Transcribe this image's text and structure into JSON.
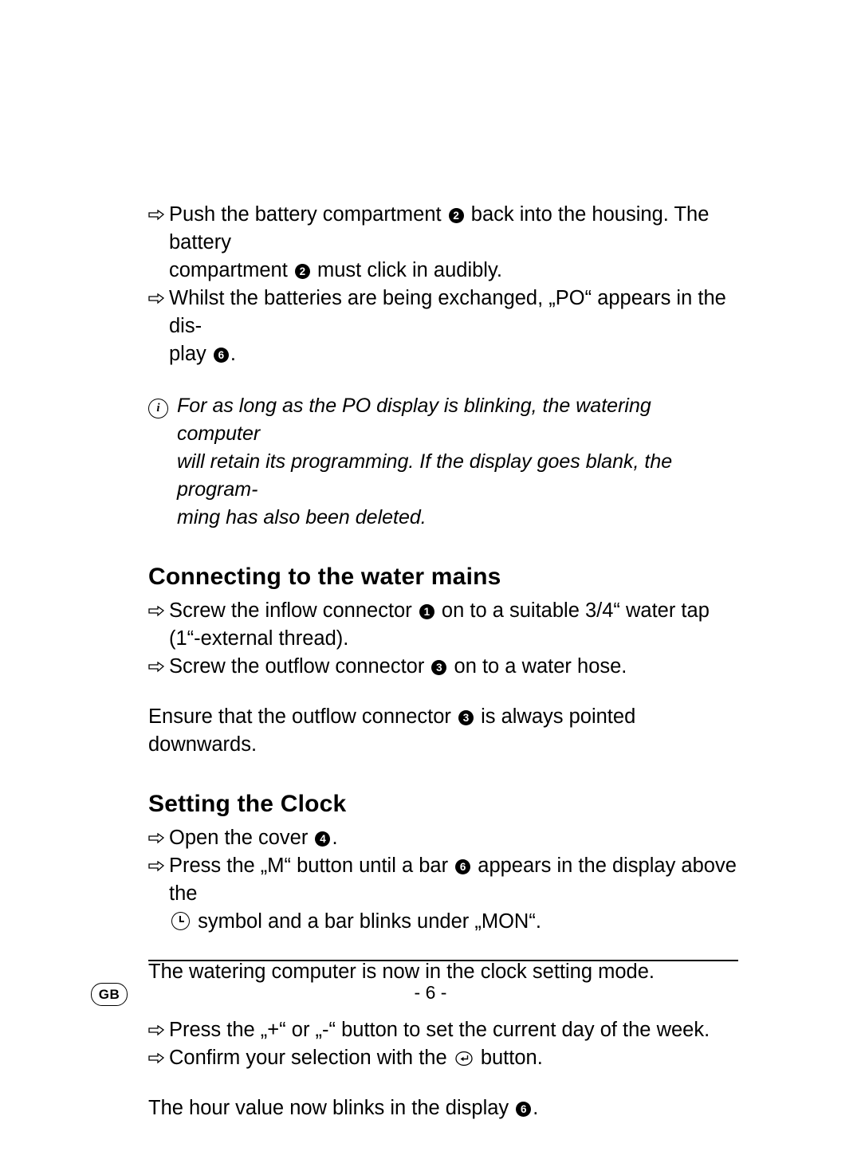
{
  "page": {
    "footer": {
      "language_badge": "GB",
      "page_number": "- 6 -"
    }
  },
  "blocks": {
    "b1": {
      "text_a": "Push the battery compartment ",
      "marker_a": "2",
      "text_b": " back into the housing. The battery",
      "text_c": "compartment ",
      "marker_b": "2",
      "text_d": " must click in audibly."
    },
    "b2": {
      "text_a": "Whilst the batteries are being exchanged, „PO“ appears in the dis-",
      "text_b": "play ",
      "marker_a": "6",
      "text_c": "."
    },
    "note": {
      "icon": "info-icon",
      "icon_glyph": "i",
      "line1": "For as long as the PO display is blinking, the watering computer",
      "line2": "will retain its programming. If the display goes blank, the program-",
      "line3": "ming has also been deleted."
    },
    "heading1": "Connecting to the water mains",
    "b3": {
      "text_a": "Screw the inflow connector ",
      "marker_a": "1",
      "text_b": " on to a suitable 3/4“ water tap",
      "text_c": "(1“-external thread)."
    },
    "b4": {
      "text_a": "Screw the outflow connector ",
      "marker_a": "3",
      "text_b": " on to a water hose."
    },
    "p1": {
      "text_a": "Ensure that the outflow connector ",
      "marker_a": "3",
      "text_b": "  is always pointed downwards."
    },
    "heading2": "Setting the Clock",
    "b5": {
      "text_a": "Open the cover ",
      "marker_a": "4",
      "text_b": "."
    },
    "b6": {
      "text_a": "Press the „M“ button until a bar ",
      "marker_a": "6",
      "text_b": " appears in the display above the",
      "text_c": " symbol and a bar blinks under „MON“.",
      "icon_clock": "clock-symbol-icon"
    },
    "p2": "The watering computer is now in the clock setting mode.",
    "b7": "Press the „+“ or „-“ button to set the current day of the week.",
    "b8": {
      "text_a": "Confirm your selection with the ",
      "icon_enter": "enter-button-icon",
      "text_b": " button."
    },
    "p3": {
      "text_a": "The hour value now blinks in the display ",
      "marker_a": "6",
      "text_b": "."
    }
  }
}
